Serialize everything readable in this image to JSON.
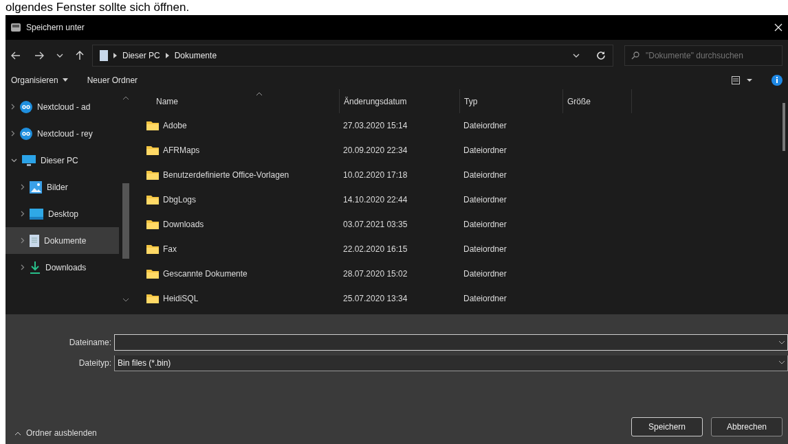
{
  "caption": "olgendes Fenster sollte sich öffnen.",
  "window": {
    "title": "Speichern unter"
  },
  "navigation": {
    "breadcrumb": [
      "Dieser PC",
      "Dokumente"
    ],
    "search": {
      "placeholder": "\"Dokumente\" durchsuchen"
    }
  },
  "toolbar": {
    "organize": "Organisieren",
    "new_folder": "Neuer Ordner"
  },
  "sidebar": {
    "items": [
      {
        "label": "Nextcloud - ad",
        "kind": "cloud",
        "expanded": false,
        "selected": false
      },
      {
        "label": "Nextcloud - rey",
        "kind": "cloud",
        "expanded": false,
        "selected": false
      },
      {
        "label": "Dieser PC",
        "kind": "pc",
        "expanded": true,
        "selected": false,
        "children": [
          {
            "label": "Bilder",
            "kind": "pictures",
            "expanded": false,
            "selected": false
          },
          {
            "label": "Desktop",
            "kind": "desktop",
            "expanded": false,
            "selected": false
          },
          {
            "label": "Dokumente",
            "kind": "documents",
            "expanded": false,
            "selected": true
          },
          {
            "label": "Downloads",
            "kind": "downloads",
            "expanded": false,
            "selected": false
          }
        ]
      }
    ]
  },
  "table": {
    "columns": [
      {
        "label": "Name",
        "sorted": true
      },
      {
        "label": "Änderungsdatum",
        "sorted": false
      },
      {
        "label": "Typ",
        "sorted": false
      },
      {
        "label": "Größe",
        "sorted": false
      }
    ],
    "rows": [
      [
        "Adobe",
        "27.03.2020 15:14",
        "Dateiordner"
      ],
      [
        "AFRMaps",
        "20.09.2020 22:34",
        "Dateiordner"
      ],
      [
        "Benutzerdefinierte Office-Vorlagen",
        "10.02.2020 17:18",
        "Dateiordner"
      ],
      [
        "DbgLogs",
        "14.10.2020 22:44",
        "Dateiordner"
      ],
      [
        "Downloads",
        "03.07.2021 03:35",
        "Dateiordner"
      ],
      [
        "Fax",
        "22.02.2020 16:15",
        "Dateiordner"
      ],
      [
        "Gescannte Dokumente",
        "28.07.2020 15:02",
        "Dateiordner"
      ],
      [
        "HeidiSQL",
        "25.07.2020 13:34",
        "Dateiordner"
      ]
    ]
  },
  "form": {
    "filename_label": "Dateiname:",
    "filetype_label": "Dateityp:",
    "filetype": "Bin files (*.bin)"
  },
  "footer": {
    "toggle": "Ordner ausblenden",
    "buttons": [
      "Speichern",
      "Abbrechen"
    ]
  }
}
